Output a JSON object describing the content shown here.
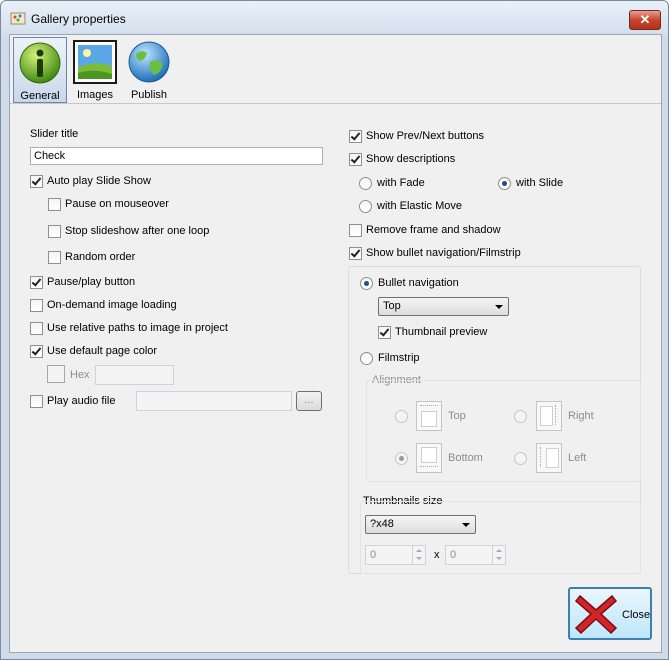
{
  "window": {
    "title": "Gallery properties",
    "close_glyph": "✕"
  },
  "toolbar": {
    "items": [
      {
        "label": "General",
        "icon": "info-icon",
        "active": true
      },
      {
        "label": "Images",
        "icon": "image-icon",
        "active": false
      },
      {
        "label": "Publish",
        "icon": "globe-icon",
        "active": false
      }
    ]
  },
  "left": {
    "slider_title_label": "Slider title",
    "slider_title_value": "Check",
    "auto_play": {
      "label": "Auto play Slide Show",
      "checked": true
    },
    "pause_mouseover": {
      "label": "Pause on mouseover",
      "checked": false
    },
    "stop_after_loop": {
      "label": "Stop slideshow after one loop",
      "checked": false
    },
    "random_order": {
      "label": "Random order",
      "checked": false
    },
    "pause_play_button": {
      "label": "Pause/play button",
      "checked": true
    },
    "on_demand_loading": {
      "label": "On-demand image loading",
      "checked": false
    },
    "relative_paths": {
      "label": "Use relative paths to image in project",
      "checked": false
    },
    "default_page_color": {
      "label": "Use default page color",
      "checked": true
    },
    "hex": {
      "label": "Hex",
      "value": ""
    },
    "play_audio": {
      "label": "Play audio file",
      "value": "",
      "browse_label": "..."
    }
  },
  "right": {
    "show_prev_next": {
      "label": "Show Prev/Next buttons",
      "checked": true
    },
    "show_descriptions": {
      "label": "Show descriptions",
      "checked": true
    },
    "with_fade": {
      "label": "with Fade",
      "selected": false
    },
    "with_slide": {
      "label": "with Slide",
      "selected": true
    },
    "with_elastic": {
      "label": "with Elastic Move",
      "selected": false
    },
    "remove_frame": {
      "label": "Remove frame and shadow",
      "checked": false
    },
    "show_bullet_nav": {
      "label": "Show bullet navigation/Filmstrip",
      "checked": true
    },
    "bullet_navigation": {
      "label": "Bullet navigation",
      "selected": true
    },
    "bullet_position": {
      "value": "Top"
    },
    "thumbnail_preview": {
      "label": "Thumbnail preview",
      "checked": true
    },
    "filmstrip": {
      "label": "Filmstrip",
      "selected": false
    },
    "alignment": {
      "label": "Alignment",
      "top": "Top",
      "right": "Right",
      "bottom": "Bottom",
      "left": "Left",
      "selected": "Bottom"
    },
    "thumbnails_size": {
      "label": "Thumbnails size",
      "value": "?x48",
      "width": "0",
      "x_label": "x",
      "height": "0"
    }
  },
  "footer": {
    "close_label": "Close"
  }
}
